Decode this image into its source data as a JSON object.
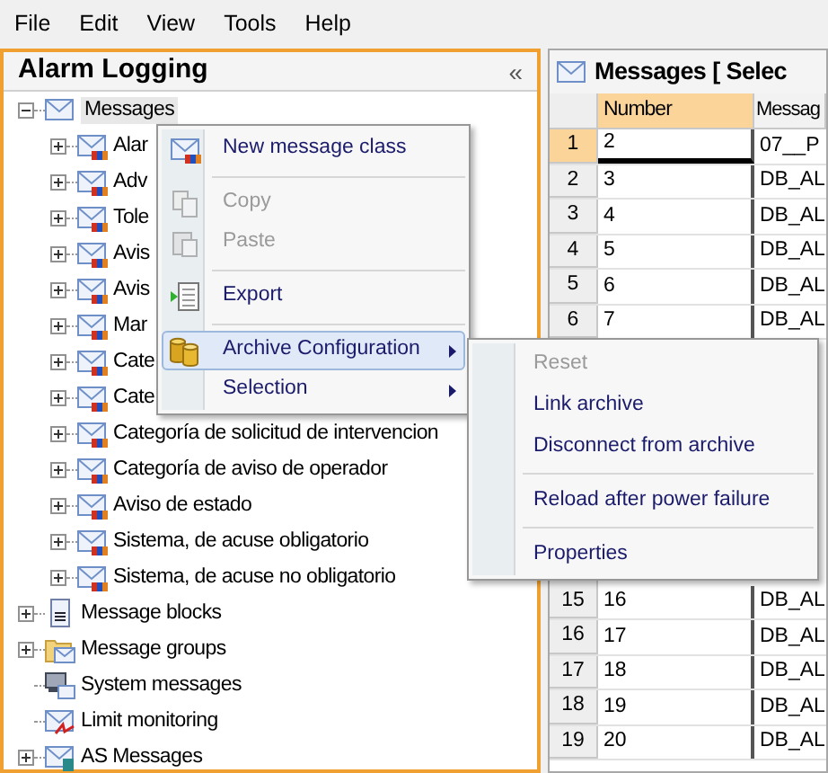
{
  "menu_bar": [
    {
      "label": "File"
    },
    {
      "label": "Edit"
    },
    {
      "label": "View"
    },
    {
      "label": "Tools"
    },
    {
      "label": "Help"
    }
  ],
  "left_panel": {
    "title": "Alarm Logging",
    "collapse": "«",
    "tree": [
      {
        "label": "Messages",
        "kind": "envelope",
        "expanded": true,
        "selected": true,
        "children": [
          {
            "label": "Alar",
            "kind": "message-class",
            "expanded": false
          },
          {
            "label": "Adv",
            "kind": "message-class",
            "expanded": false
          },
          {
            "label": "Tole",
            "kind": "message-class",
            "expanded": false
          },
          {
            "label": "Avis",
            "kind": "message-class",
            "expanded": false
          },
          {
            "label": "Avis",
            "kind": "message-class",
            "expanded": false
          },
          {
            "label": "Mar",
            "kind": "message-class",
            "expanded": false
          },
          {
            "label": "Cate",
            "kind": "message-class",
            "expanded": false
          },
          {
            "label": "Cate",
            "kind": "message-class",
            "expanded": false
          },
          {
            "label": "Categoría de solicitud de intervencion",
            "kind": "message-class",
            "expanded": false
          },
          {
            "label": "Categoría de aviso de operador",
            "kind": "message-class",
            "expanded": false
          },
          {
            "label": "Aviso de estado",
            "kind": "message-class",
            "expanded": false
          },
          {
            "label": "Sistema, de acuse obligatorio",
            "kind": "message-class",
            "expanded": false
          },
          {
            "label": "Sistema, de acuse no obligatorio",
            "kind": "message-class",
            "expanded": false
          }
        ]
      },
      {
        "label": "Message blocks",
        "kind": "blocks",
        "expanded": false,
        "selected": false
      },
      {
        "label": "Message groups",
        "kind": "folder",
        "expanded": false,
        "selected": false
      },
      {
        "label": "System messages",
        "kind": "system",
        "selected": false
      },
      {
        "label": "Limit monitoring",
        "kind": "limit",
        "selected": false
      },
      {
        "label": "AS Messages",
        "kind": "as",
        "expanded": false,
        "selected": false
      }
    ]
  },
  "grid_panel": {
    "title": "Messages [ Selec",
    "columns": [
      {
        "label": "Number",
        "selected": true
      },
      {
        "label": "Messag",
        "selected": false
      }
    ],
    "rows": [
      {
        "header": "1",
        "cells": [
          "2",
          "07__P"
        ],
        "selected": true
      },
      {
        "header": "2",
        "cells": [
          "3",
          "DB_AL"
        ],
        "selected": false
      },
      {
        "header": "3",
        "cells": [
          "4",
          "DB_AL"
        ],
        "selected": false
      },
      {
        "header": "4",
        "cells": [
          "5",
          "DB_AL"
        ],
        "selected": false
      },
      {
        "header": "5",
        "cells": [
          "6",
          "DB_AL"
        ],
        "selected": false
      },
      {
        "header": "6",
        "cells": [
          "7",
          "DB_AL"
        ],
        "selected": false
      }
    ],
    "rows_below_menu": [
      {
        "header": "15",
        "cells": [
          "16",
          "DB_AL"
        ],
        "selected": false
      },
      {
        "header": "16",
        "cells": [
          "17",
          "DB_AL"
        ],
        "selected": false
      },
      {
        "header": "17",
        "cells": [
          "18",
          "DB_AL"
        ],
        "selected": false
      },
      {
        "header": "18",
        "cells": [
          "19",
          "DB_AL"
        ],
        "selected": false
      },
      {
        "header": "19",
        "cells": [
          "20",
          "DB_AL"
        ],
        "selected": false
      }
    ]
  },
  "context_menu": {
    "items": [
      {
        "kind": "item",
        "label": "New message class",
        "disabled": false,
        "selected": false
      },
      {
        "kind": "separator"
      },
      {
        "kind": "item",
        "label": "Copy",
        "disabled": true,
        "selected": false
      },
      {
        "kind": "item",
        "label": "Paste",
        "disabled": true,
        "selected": false
      },
      {
        "kind": "separator"
      },
      {
        "kind": "item",
        "label": "Export",
        "disabled": false,
        "selected": false
      },
      {
        "kind": "separator"
      },
      {
        "kind": "item",
        "label": "Archive Configuration",
        "disabled": false,
        "selected": true,
        "submenu": true
      },
      {
        "kind": "item",
        "label": "Selection",
        "disabled": false,
        "selected": false,
        "submenu": true
      }
    ]
  },
  "submenu": {
    "items": [
      {
        "kind": "item",
        "label": "Reset",
        "disabled": true
      },
      {
        "kind": "item",
        "label": "Link archive",
        "disabled": false
      },
      {
        "kind": "item",
        "label": "Disconnect from archive",
        "disabled": false
      },
      {
        "kind": "separator"
      },
      {
        "kind": "item",
        "label": "Reload after power failure",
        "disabled": false
      },
      {
        "kind": "separator"
      },
      {
        "kind": "item",
        "label": "Properties",
        "disabled": false
      }
    ]
  }
}
